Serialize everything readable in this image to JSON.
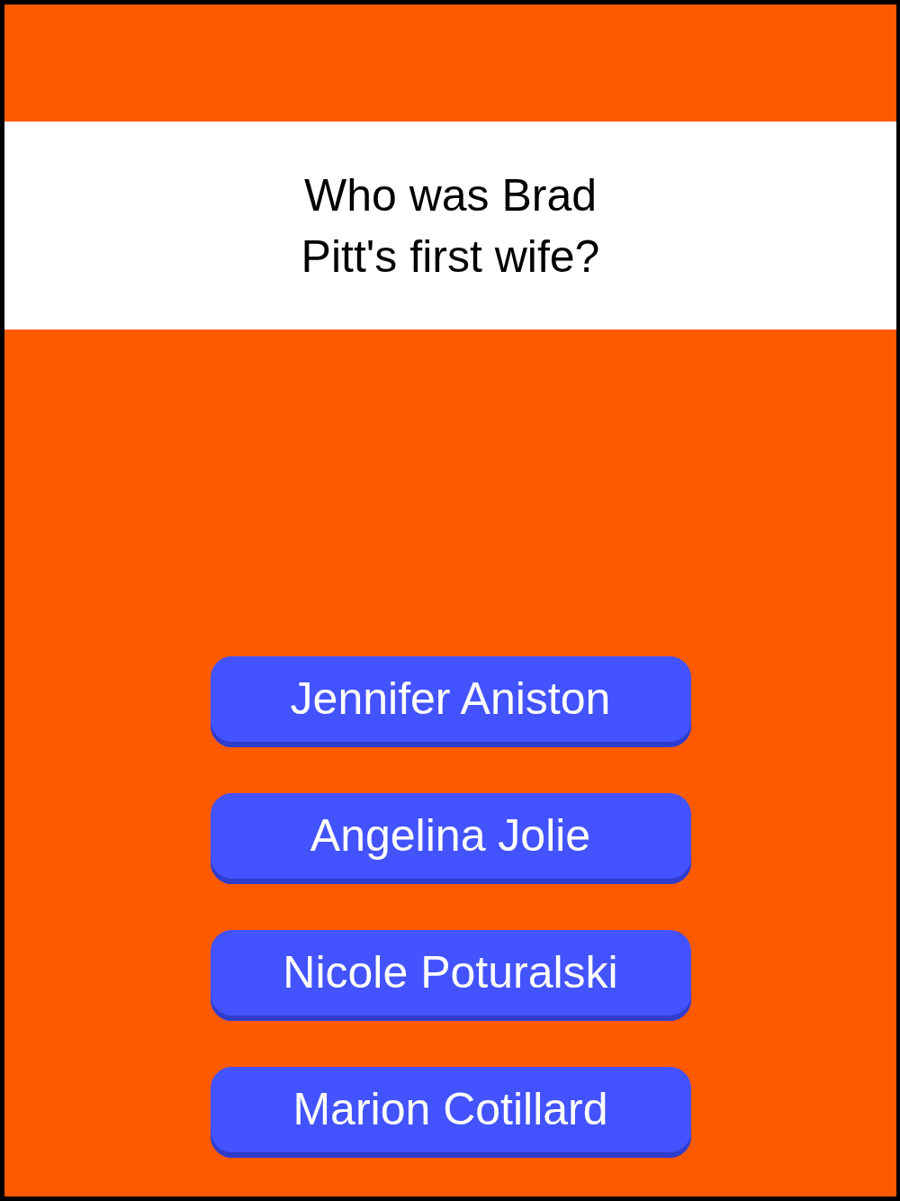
{
  "question": "Who was Brad Pitt's first wife?",
  "answers": [
    {
      "label": "Jennifer Aniston"
    },
    {
      "label": "Angelina Jolie"
    },
    {
      "label": "Nicole Poturalski"
    },
    {
      "label": "Marion Cotillard"
    }
  ]
}
